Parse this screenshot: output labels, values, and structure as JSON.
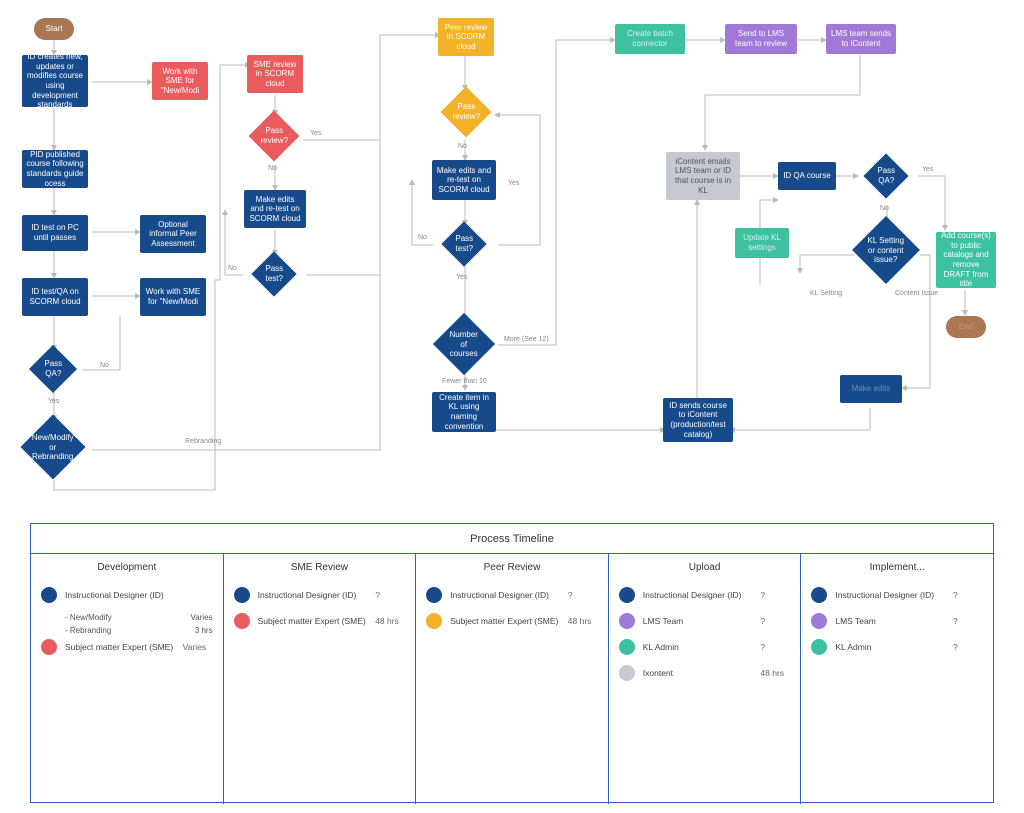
{
  "nodes": {
    "start": "Start",
    "end": "End",
    "id_creates": "ID creates new, updates or modifies course using development standards",
    "work_sme1": "Work with SME for \"New/Modi",
    "pid": "PID published course following standards guide ocess",
    "id_test_pc": "ID test on PC until passes",
    "optional_peer": "Optional informal Peer Assessment",
    "id_test_scorm": "ID test/QA on SCORM cloud",
    "work_sme2": "Work with SME for \"New/Modi",
    "pass_qa1": "Pass QA?",
    "new_modify": "New/Modify or Rebranding",
    "sme_review": "SME review in SCORM cloud",
    "pass_review1": "Pass review?",
    "make_edits1": "Make edits and re-test on SCORM cloud",
    "pass_test1": "Pass test?",
    "peer_review": "Peer review in SCORM cloud",
    "pass_review2": "Pass review?",
    "make_edits2": "Make edits and re-test on SCORM cloud",
    "pass_test2": "Pass test?",
    "num_courses": "Number of courses",
    "create_item_kl": "Create item in KL using naming convention",
    "create_batch": "Create batch connector",
    "send_lms": "Send to LMS team to review",
    "lms_sends": "LMS team sends to iContent",
    "icontent_emails": "iContent emails LMS team or ID that course is in KL",
    "id_qa_course": "ID QA course",
    "pass_qa2": "Pass QA?",
    "update_kl": "Update KL settings",
    "kl_setting_issue": "KL Setting or content issue?",
    "make_edits_final": "Make edits",
    "add_courses": "Add course(s) to public catalogs and remove DRAFT from title",
    "id_sends_icontent": "ID sends course to iContent (production/test catalog)"
  },
  "labels": {
    "yes": "Yes",
    "no": "No",
    "rebranding": "Rebranding",
    "more": "More (See 12)",
    "fewer": "Fewer than 10",
    "kl_setting": "KL Setting",
    "content_issue": "Content Issue"
  },
  "timeline": {
    "title": "Process Timeline",
    "cols": [
      {
        "name": "Development",
        "rows": [
          {
            "color": "#164a8a",
            "label": "Instructional Designer (ID)",
            "value": ""
          },
          {
            "sub": [
              [
                "- New/Modify",
                "Varies"
              ],
              [
                "- Rebranding",
                "3 hrs"
              ]
            ]
          },
          {
            "color": "#ea5b5e",
            "label": "Subject matter Expert (SME)",
            "value": "Varies"
          }
        ]
      },
      {
        "name": "SME Review",
        "rows": [
          {
            "color": "#164a8a",
            "label": "Instructional Designer (ID)",
            "value": "?"
          },
          {
            "color": "#ea5b5e",
            "label": "Subject matter Expert (SME)",
            "value": "48 hrs"
          }
        ]
      },
      {
        "name": "Peer Review",
        "rows": [
          {
            "color": "#164a8a",
            "label": "Instructional Designer (ID)",
            "value": "?"
          },
          {
            "color": "#f3b228",
            "label": "Subject matter Expert (SME)",
            "value": "48 hrs"
          }
        ]
      },
      {
        "name": "Upload",
        "rows": [
          {
            "color": "#164a8a",
            "label": "Instructional Designer (ID)",
            "value": "?"
          },
          {
            "color": "#9f78d8",
            "label": "LMS Team",
            "value": "?"
          },
          {
            "color": "#3ec1a1",
            "label": "KL Admin",
            "value": "?"
          },
          {
            "color": "#c6c9cf",
            "label": "Ixontent",
            "value": "48 hrs"
          }
        ]
      },
      {
        "name": "Implement...",
        "rows": [
          {
            "color": "#164a8a",
            "label": "Instructional Designer (ID)",
            "value": "?"
          },
          {
            "color": "#9f78d8",
            "label": "LMS Team",
            "value": "?"
          },
          {
            "color": "#3ec1a1",
            "label": "KL Admin",
            "value": "?"
          }
        ]
      }
    ]
  }
}
